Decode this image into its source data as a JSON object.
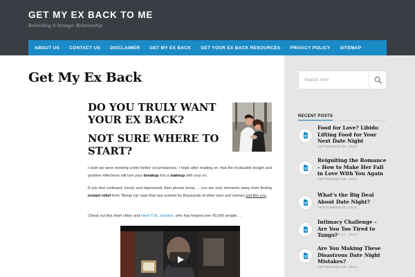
{
  "site": {
    "title": "GET MY EX BACK TO ME",
    "tagline": "Rebuilding A Stronger Relationship"
  },
  "nav": {
    "items": [
      "ABOUT US",
      "CONTACT US",
      "DISCLAIMER",
      "GET MY EX BACK",
      "GET YOUR EX BACK RESOURCES",
      "PRIVACY POLICY",
      "SITEMAP"
    ]
  },
  "main": {
    "page_title": "Get My Ex Back",
    "heading_1": "DO YOU TRULY WANT YOUR EX BACK?",
    "heading_2": "NOT SURE WHERE TO START?",
    "p1": {
      "before": "I wish we were meeting under better circumstances. I hope after reading on, that the invaluable insight and positive reflections will turn your ",
      "bold1": "breakup",
      "middle": " into a ",
      "bold2": "makeup",
      "after": " with your ex."
    },
    "p2": {
      "before": "If you feel confused, lonely and depressed, then please know…. you are only moments away from finding ",
      "bold": "instant relief",
      "middle": " from \"Break Up\" pain that has worked for thousands of other men and women ",
      "underline": "just like you",
      "after": "."
    },
    "p3": {
      "before": "Check out this short video and ",
      "link": "meet T.W. Jackson",
      "after": ", who has helped over 50,000 people…."
    }
  },
  "sidebar": {
    "search_placeholder": "Search form",
    "recent_title": "RECENT POSTS",
    "posts": [
      {
        "title": "Food for Love? Libido Lifting Food for Your Next Date Night",
        "date": "SEPTEMBER 30, 2013"
      },
      {
        "title": "Reigniting the Romance – How to Make Her Fall in Love With You Again",
        "date": "SEPTEMBER 29, 2013"
      },
      {
        "title": "What’s the Big Deal About Date Night?",
        "date": "SEPTEMBER 28, 2013"
      },
      {
        "title": "Intimacy Challenge – Are You Too Tired to Tango?",
        "date": "SEPTEMBER 27, 2013"
      },
      {
        "title": "Are You Making These Disastrous Date Night Mistakes?",
        "date": "SEPTEMBER 26, 2013"
      }
    ]
  },
  "colors": {
    "header_bg": "#3a3e44",
    "nav_bg": "#1b8bc7",
    "accent": "#1b8bc7",
    "sidebar_bg": "#e6e6e6"
  },
  "icons": {
    "search": "search-icon",
    "post": "document-icon",
    "play": "play-icon"
  }
}
